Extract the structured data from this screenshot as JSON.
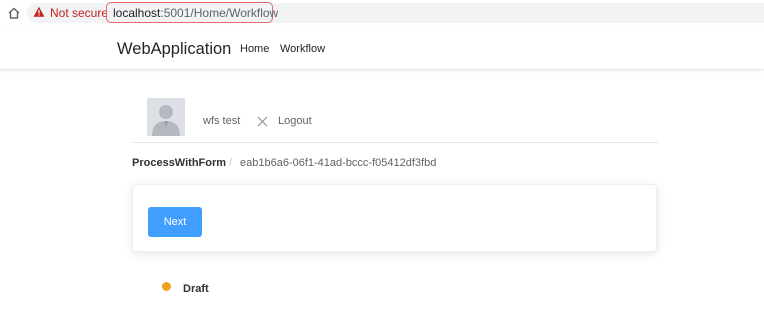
{
  "browser": {
    "security_label": "Not secure",
    "url_host": "localhost",
    "url_rest": ":5001/Home/Workflow",
    "warning_color": "#c5221f",
    "icons": {
      "home": "home-icon",
      "warning": "warning-triangle-icon"
    }
  },
  "navbar": {
    "brand": "WebApplication",
    "links": [
      {
        "label": "Home"
      },
      {
        "label": "Workflow"
      }
    ]
  },
  "user": {
    "name": "wfs test",
    "logout_label": "Logout",
    "icons": {
      "avatar": "user-avatar-icon",
      "logout": "close-icon"
    }
  },
  "breadcrumb": {
    "process": "ProcessWithForm",
    "separator": "/",
    "instance_id": "eab1b6a6-06f1-41ad-bccc-f05412df3fbd"
  },
  "actions": {
    "next_label": "Next",
    "button_color": "#409eff"
  },
  "status": {
    "label": "Draft",
    "color": "#f0a020"
  }
}
